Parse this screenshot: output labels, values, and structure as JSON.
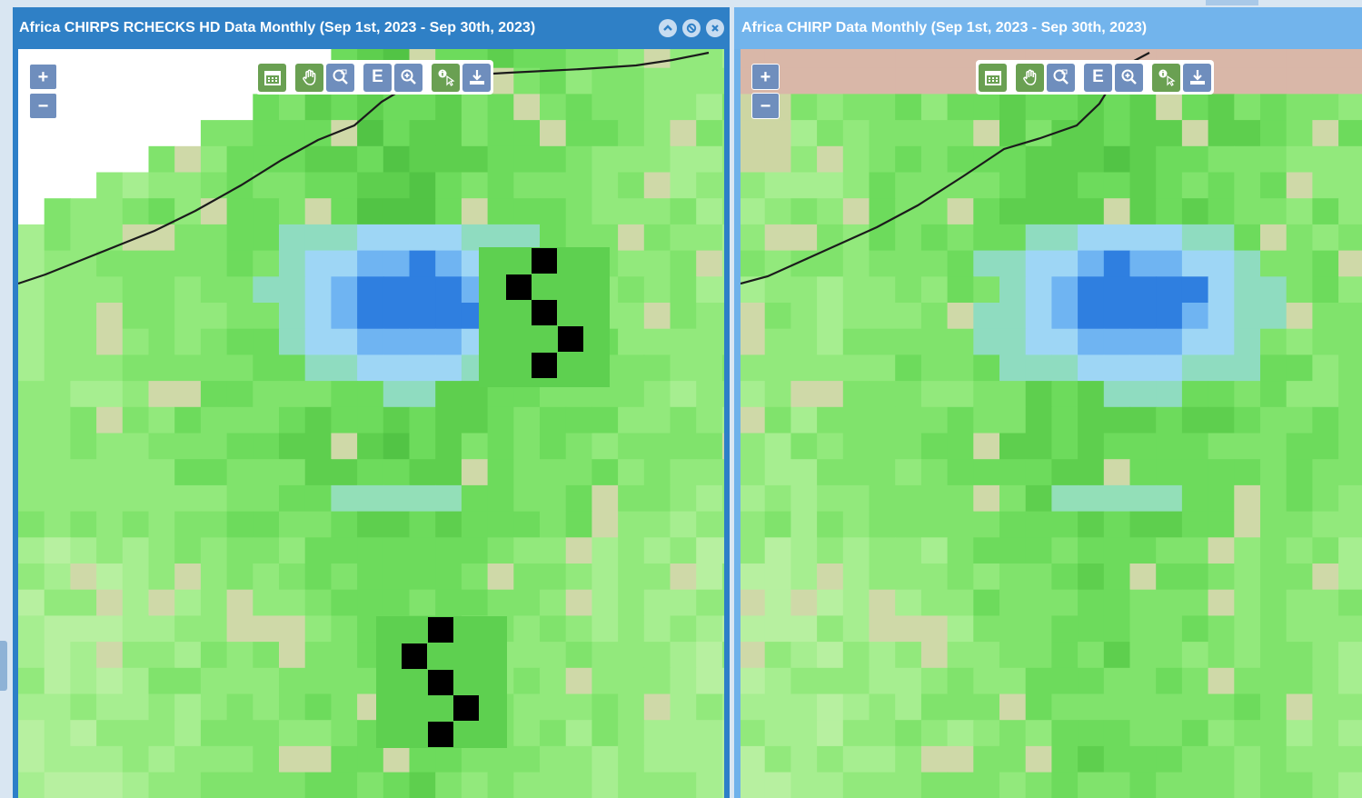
{
  "left_panel": {
    "title": "Africa CHIRPS RCHECKS HD Data Monthly (Sep 1st, 2023 - Sep 30th, 2023)",
    "window_buttons": [
      "chevron-up-icon",
      "ban-icon",
      "close-icon"
    ]
  },
  "right_panel": {
    "title": "Africa CHIRP Data Monthly (Sep 1st, 2023 - Sep 30th, 2023)"
  },
  "zoom": {
    "in_label": "+",
    "out_label": "−"
  },
  "toolbar": {
    "tools": [
      "calendar-icon",
      "pan-hand-icon",
      "zoom-box-icon",
      "edit-icon",
      "zoom-in-icon",
      "info-pointer-icon",
      "download-icon"
    ],
    "edit_label": "E"
  },
  "colors": {
    "title_bar_active": "#2f80c6",
    "title_bar_inactive": "#72b4ec",
    "tool_green": "#6aa052",
    "tool_blue": "#6f8ebd",
    "rain_high": "#2f7fe0",
    "rain_mid": "#8ec9f2",
    "rain_low": "#5ccc4e",
    "dry": "#d4b4a8",
    "flag_marker": "#000000"
  }
}
